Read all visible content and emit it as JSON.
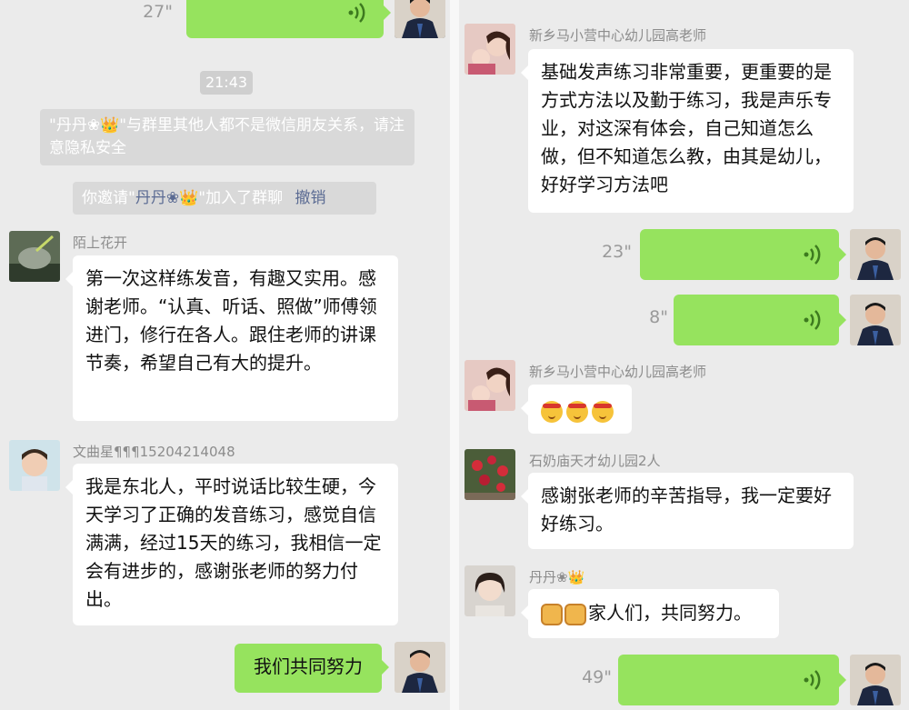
{
  "left": {
    "top_voice": {
      "duration": "27\""
    },
    "time": "21:43",
    "notice": {
      "text": "\"丹丹❀👑\"与群里其他人都不是微信朋友关系，请注意隐私安全"
    },
    "invite": {
      "prefix": "你邀请\"",
      "name": "丹丹❀👑",
      "suffix": "\"加入了群聊",
      "action": "撤销"
    },
    "messages": [
      {
        "name": "陌上花开",
        "text": "第一次这样练发音，有趣又实用。感谢老师。“认真、听话、照做”师傅领进门，修行在各人。跟住老师的讲课节奏，希望自己有大的提升。"
      },
      {
        "name": "文曲星¶¶¶15204214048",
        "text": "我是东北人，平时说话比较生硬，今天学习了正确的发音练习，感觉自信满满，经过15天的练习，我相信一定会有进步的，感谢张老师的努力付出。"
      }
    ],
    "self_message": {
      "text": "我们共同努力"
    }
  },
  "right": {
    "messages": [
      {
        "name": "新乡马小营中心幼儿园高老师",
        "text": "基础发声练习非常重要，更重要的是方式方法以及勤于练习，我是声乐专业，对这深有体会，自己知道怎么做，但不知道怎么教，由其是幼儿，好好学习方法吧"
      },
      {
        "name": "新乡马小营中心幼儿园高老师",
        "emoji": "😓😓😓"
      },
      {
        "name": "石奶庙天才幼儿园2人",
        "text": "感谢张老师的辛苦指导，我一定要好好练习。"
      },
      {
        "name": "丹丹❀👑",
        "text": "家人们，共同努力。"
      }
    ],
    "voices": [
      {
        "duration": "23\""
      },
      {
        "duration": "8\""
      },
      {
        "duration": "49\""
      }
    ]
  },
  "colors": {
    "self_bubble": "#96e35e",
    "background": "#ebebeb",
    "link": "#5b6b93"
  }
}
